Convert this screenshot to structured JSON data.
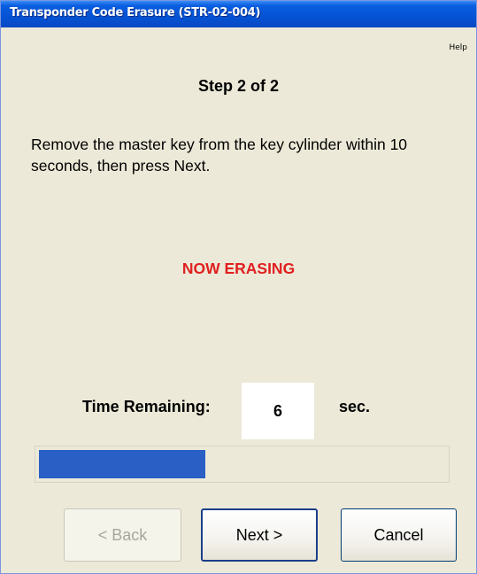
{
  "window": {
    "title": "Transponder Code Erasure (STR-02-004)"
  },
  "menu": {
    "help_label": "Help"
  },
  "content": {
    "step_title": "Step 2 of 2",
    "instructions": "Remove the master key from the key cylinder within 10 seconds, then press Next.",
    "status_text": "NOW ERASING",
    "status_color": "#e02020"
  },
  "timer": {
    "label": "Time Remaining:",
    "value": "6",
    "unit": "sec."
  },
  "progress": {
    "fraction": 0.41,
    "color": "#2a5fc6"
  },
  "buttons": {
    "back_label": "< Back",
    "back_enabled": false,
    "next_label": "Next >",
    "cancel_label": "Cancel"
  }
}
